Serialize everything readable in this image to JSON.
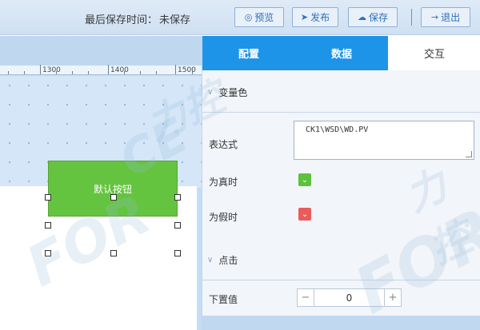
{
  "header": {
    "save_status_label": "最后保存时间：",
    "save_status_value": "未保存",
    "buttons": {
      "preview": "预览",
      "publish": "发布",
      "save": "保存",
      "exit": "退出"
    }
  },
  "ruler": {
    "labels": [
      "1300",
      "1400",
      "1500"
    ]
  },
  "canvas": {
    "button_widget_label": "默认按钮"
  },
  "panel": {
    "tabs": [
      "配置",
      "数据",
      "交互"
    ],
    "active_tab": "交互",
    "section_variable_color": "变量色",
    "expression_label": "表达式",
    "expression_value": "CK1\\WSD\\WD.PV",
    "true_label": "为真时",
    "false_label": "为假时",
    "section_click": "点击",
    "setvalue_label": "下置值",
    "setvalue_value": "0",
    "colors": {
      "true_color": "#5cc13b",
      "false_color": "#ea5b5b"
    }
  },
  "watermark": {
    "brand": "FORCECON",
    "cn": "力控"
  }
}
